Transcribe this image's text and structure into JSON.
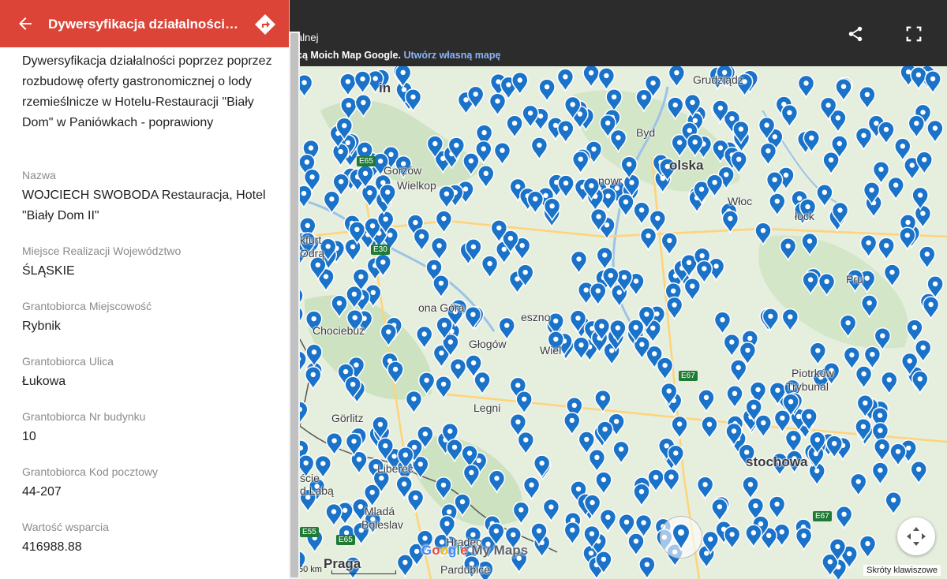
{
  "panel": {
    "title": "Dywersyfikacja działalności p...",
    "description": "Dywersyfikacja działalności poprzez poprzez rozbudowę oferty gastronomicznej o lody rzemieślnicze w Hotelu-Restauracji \"Biały Dom\" w Paniówkach - poprawiony",
    "fields": [
      {
        "label": "Nazwa",
        "value": "WOJCIECH SWOBODA Restauracja, Hotel \"Biały Dom II\""
      },
      {
        "label": "Miejsce Realizacji Województwo",
        "value": "ŚLĄSKIE"
      },
      {
        "label": "Grantobiorca Miejscowość",
        "value": "Rybnik"
      },
      {
        "label": "Grantobiorca Ulica",
        "value": "Łukowa"
      },
      {
        "label": "Grantobiorca Nr budynku",
        "value": "10"
      },
      {
        "label": "Grantobiorca Kod pocztowy",
        "value": "44-207"
      },
      {
        "label": "Wartość wsparcia",
        "value": "416988.88"
      }
    ],
    "accent_color": "#db4437"
  },
  "header": {
    "line1": "alnej",
    "line2_prefix": "cą Moich Map Google.",
    "line2_link": "Utwórz własną mapę"
  },
  "map": {
    "marker_color": "#1a73c8",
    "cities": [
      {
        "name": "Grudziądz"
      },
      {
        "name": "Byd"
      },
      {
        "name": "olska",
        "big": true
      },
      {
        "name": "Gorzów"
      },
      {
        "name": "Wielkop"
      },
      {
        "name": "nowr"
      },
      {
        "name": "Włoc"
      },
      {
        "name": "łock"
      },
      {
        "name": "kfurt"
      },
      {
        "name": "Odrą"
      },
      {
        "name": "ona Góra"
      },
      {
        "name": "Chociebuż"
      },
      {
        "name": "eszno"
      },
      {
        "name": "Głogów"
      },
      {
        "name": "Wiel"
      },
      {
        "name": "Piotrków"
      },
      {
        "name": "Trybunal"
      },
      {
        "name": "Görlitz"
      },
      {
        "name": "Legni"
      },
      {
        "name": "stochowa"
      },
      {
        "name": "Liberec"
      },
      {
        "name": "ście"
      },
      {
        "name": "d Labą"
      },
      {
        "name": "Mladá"
      },
      {
        "name": "Boleslav"
      },
      {
        "name": "Hradec"
      },
      {
        "name": "Pardubice"
      },
      {
        "name": "Praga"
      },
      {
        "name": "in"
      },
      {
        "name": "Pru"
      }
    ],
    "roads": [
      "E65",
      "E30",
      "E67",
      "E65",
      "E55",
      "E67"
    ],
    "logo": "Google My Maps",
    "scale_label": "50 km",
    "shortcuts": "Skróty klawiszowe"
  }
}
